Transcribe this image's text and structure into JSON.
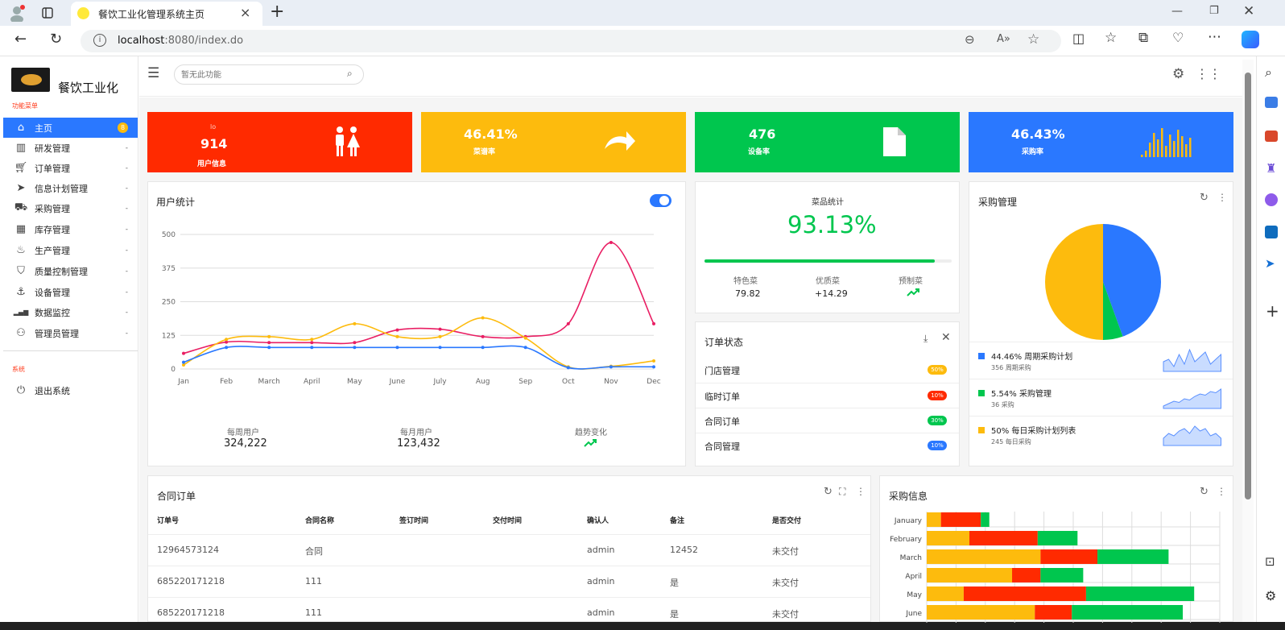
{
  "browser": {
    "tab_title": "餐饮工业化管理系统主页",
    "url_host": "localhost",
    "url_rest": ":8080/index.do"
  },
  "colors": {
    "red": "#ff2a00",
    "yellow": "#fdbb0d",
    "green": "#00c64e",
    "blue": "#2a78ff",
    "pink": "#e91e63"
  },
  "sidebar": {
    "brand": "餐饮工业化",
    "section1": "功能菜单",
    "section2": "系统",
    "items": [
      {
        "label": "主页",
        "icon": "home-icon",
        "badge": "8"
      },
      {
        "label": "研发管理",
        "icon": "book-icon",
        "caret": "-"
      },
      {
        "label": "订单管理",
        "icon": "cart-icon",
        "caret": "-"
      },
      {
        "label": "信息计划管理",
        "icon": "send-icon",
        "caret": "-"
      },
      {
        "label": "采购管理",
        "icon": "truck-icon",
        "caret": "-"
      },
      {
        "label": "库存管理",
        "icon": "grid-icon",
        "caret": "-"
      },
      {
        "label": "生产管理",
        "icon": "fire-icon",
        "caret": "-"
      },
      {
        "label": "质量控制管理",
        "icon": "html5-icon",
        "caret": "-"
      },
      {
        "label": "设备管理",
        "icon": "anchor-icon",
        "caret": "-"
      },
      {
        "label": "数据监控",
        "icon": "signal-icon",
        "caret": "-"
      },
      {
        "label": "管理员管理",
        "icon": "user-icon",
        "caret": "-"
      }
    ],
    "logout": "退出系统"
  },
  "topbar": {
    "search_placeholder": "暂无此功能"
  },
  "stats": [
    {
      "small": "lo",
      "value": "914",
      "label": "用户信息",
      "icon": "people-icon"
    },
    {
      "value": "46.41%",
      "label": "菜谱率",
      "icon": "share-arrow-icon"
    },
    {
      "value": "476",
      "label": "设备率",
      "icon": "file-icon"
    },
    {
      "value": "46.43%",
      "label": "采购率",
      "icon": "bar-spark-icon"
    }
  ],
  "user_stats": {
    "title": "用户统计",
    "summary": [
      {
        "label": "每周用户",
        "value": "324,222"
      },
      {
        "label": "每月用户",
        "value": "123,432"
      },
      {
        "label": "趋势变化",
        "icon": "trend-up-icon"
      }
    ]
  },
  "chart_data": {
    "type": "line",
    "categories": [
      "Jan",
      "Feb",
      "March",
      "April",
      "May",
      "June",
      "July",
      "Aug",
      "Sep",
      "Oct",
      "Nov",
      "Dec"
    ],
    "yticks": [
      0,
      125,
      250,
      375,
      500
    ],
    "ylim": [
      0,
      500
    ],
    "series": [
      {
        "color": "#e91e63",
        "values": [
          58,
          100,
          98,
          98,
          98,
          145,
          148,
          120,
          120,
          168,
          470,
          168
        ]
      },
      {
        "color": "#fdbb0d",
        "values": [
          15,
          110,
          120,
          110,
          168,
          120,
          120,
          190,
          115,
          8,
          10,
          30
        ]
      },
      {
        "color": "#2a78ff",
        "values": [
          25,
          80,
          80,
          80,
          80,
          80,
          80,
          80,
          80,
          5,
          8,
          8
        ]
      }
    ]
  },
  "dish_stats": {
    "title": "菜品统计",
    "percent": "93.13%",
    "progress": 0.93,
    "cols": [
      {
        "label": "特色菜",
        "value": "79.82"
      },
      {
        "label": "优质菜",
        "value": "+14.29"
      },
      {
        "label": "预制菜",
        "icon": "trend-up-icon"
      }
    ]
  },
  "order_status": {
    "title": "订单状态",
    "rows": [
      {
        "label": "门店管理",
        "badge": "50%",
        "color": "#fdbb0d"
      },
      {
        "label": "临时订单",
        "badge": "10%",
        "color": "#ff2a00"
      },
      {
        "label": "合同订单",
        "badge": "30%",
        "color": "#00c64e"
      },
      {
        "label": "合同管理",
        "badge": "10%",
        "color": "#2a78ff"
      }
    ]
  },
  "purchase_mgmt": {
    "title": "采购管理",
    "pie": [
      {
        "value": 44.46,
        "color": "#2a78ff"
      },
      {
        "value": 5.54,
        "color": "#00c64e"
      },
      {
        "value": 50,
        "color": "#fdbb0d"
      }
    ],
    "legend": [
      {
        "title": "44.46% 周期采购计划",
        "sub": "356 周期采购",
        "color": "#2a78ff"
      },
      {
        "title": "5.54% 采购管理",
        "sub": "36 采购",
        "color": "#00c64e"
      },
      {
        "title": "50% 每日采购计划列表",
        "sub": "245 每日采购",
        "color": "#fdbb0d"
      }
    ]
  },
  "contract": {
    "title": "合同订单",
    "headers": [
      "订单号",
      "合同名称",
      "签订时间",
      "交付时间",
      "确认人",
      "备注",
      "是否交付"
    ],
    "rows": [
      [
        "12964573124",
        "合同",
        "",
        "",
        "admin",
        "12452",
        "未交付"
      ],
      [
        "685220171218",
        "111",
        "",
        "",
        "admin",
        "是",
        "未交付"
      ],
      [
        "685220171218",
        "111",
        "",
        "",
        "admin",
        "是",
        "未交付"
      ]
    ]
  },
  "purchase_info": {
    "title": "采购信息",
    "months": [
      "January",
      "February",
      "March",
      "April",
      "May",
      "June"
    ],
    "stack": [
      [
        5,
        14,
        3
      ],
      [
        15,
        24,
        14
      ],
      [
        40,
        20,
        25
      ],
      [
        30,
        10,
        15
      ],
      [
        13,
        43,
        38
      ],
      [
        38,
        13,
        39
      ]
    ]
  }
}
